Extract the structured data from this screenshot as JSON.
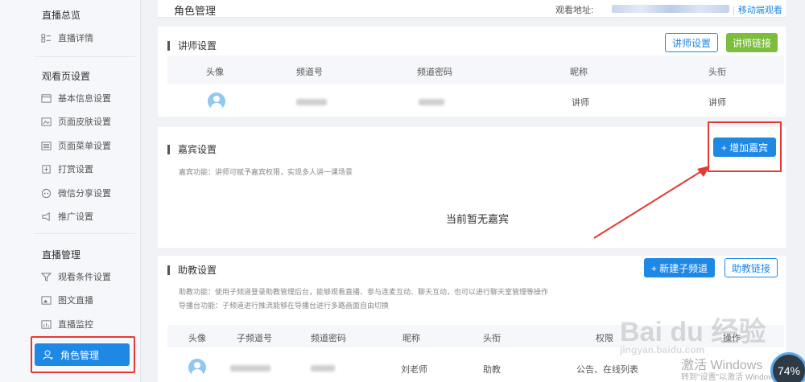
{
  "sidebar": {
    "sections": [
      {
        "title": "直播总览",
        "items": [
          {
            "label": "直播详情",
            "icon": "list-icon"
          }
        ]
      },
      {
        "title": "观看页设置",
        "items": [
          {
            "label": "基本信息设置",
            "icon": "window-icon"
          },
          {
            "label": "页面皮肤设置",
            "icon": "image-edit-icon"
          },
          {
            "label": "页面菜单设置",
            "icon": "menu-list-icon"
          },
          {
            "label": "打赏设置",
            "icon": "gift-icon"
          },
          {
            "label": "微信分享设置",
            "icon": "share-icon"
          },
          {
            "label": "推广设置",
            "icon": "megaphone-icon"
          }
        ]
      },
      {
        "title": "直播管理",
        "items": [
          {
            "label": "观看条件设置",
            "icon": "filter-icon"
          },
          {
            "label": "图文直播",
            "icon": "picture-icon"
          },
          {
            "label": "直播监控",
            "icon": "chart-icon"
          }
        ]
      }
    ],
    "active": {
      "label": "角色管理",
      "icon": "user-role-icon"
    }
  },
  "header": {
    "title": "角色管理",
    "watch_label": "观看地址:",
    "mobile_link": "移动端观看"
  },
  "lecturer": {
    "title": "讲师设置",
    "btn_settings": "讲师设置",
    "btn_link": "讲师链接",
    "columns": [
      "头像",
      "频道号",
      "频道密码",
      "昵称",
      "头衔"
    ],
    "row": {
      "nickname": "讲师",
      "title": "讲师"
    }
  },
  "guest": {
    "title": "嘉宾设置",
    "desc": "嘉宾功能：讲师可赋予嘉宾权限，实现多人讲一课场景",
    "btn_add": "+ 增加嘉宾",
    "empty": "当前暂无嘉宾"
  },
  "assistant": {
    "title": "助教设置",
    "btn_new": "+ 新建子频道",
    "btn_link": "助教链接",
    "desc1": "助教功能：使用子频道登录助教管理后台，能够观看直播、参与连麦互动、聊天互动，也可以进行聊天室管理等操作",
    "desc2": "导播台功能：子频道进行推流能够在导播台进行多路画面自由切换",
    "columns": [
      "头像",
      "子频道号",
      "频道密码",
      "昵称",
      "头衔",
      "权限",
      "操作"
    ],
    "row": {
      "nickname": "刘老师",
      "title": "助教",
      "permission": "公告、在线列表"
    }
  },
  "watermark": {
    "brand": "Bai du 经验",
    "site": "jingyan.baidu.com",
    "activate1": "激活 Windows",
    "activate2": "转到\"设置\"以激活 Windows。",
    "gauge": "74%"
  },
  "colors": {
    "accent": "#1e88e5",
    "green": "#7cbd3b",
    "highlight": "#e53935"
  }
}
